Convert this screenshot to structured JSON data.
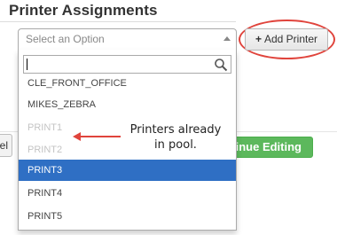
{
  "section": {
    "title": "Printer Assignments"
  },
  "select": {
    "placeholder": "Select an Option",
    "search_value": ""
  },
  "add_button": {
    "label": "Add Printer",
    "icon": "plus-icon"
  },
  "options": [
    {
      "label": "CLE_FRONT_OFFICE",
      "disabled": false
    },
    {
      "label": "MIKES_ZEBRA",
      "disabled": false
    },
    {
      "label": "PRINT1",
      "disabled": true
    },
    {
      "label": "PRINT2",
      "disabled": true
    },
    {
      "label": "PRINT3",
      "disabled": false,
      "highlighted": true
    },
    {
      "label": "PRINT4",
      "disabled": false
    },
    {
      "label": "PRINT5",
      "disabled": false
    }
  ],
  "annotation": {
    "line1": "Printers already",
    "line2": "in pool."
  },
  "background_buttons": {
    "cancel_partial": "el",
    "continue_partial": "tinue Editing"
  },
  "colors": {
    "highlight": "#2f6fc4",
    "continue_green": "#5cb85c",
    "annotation_red": "#e0443c",
    "disabled_text": "#c4c4c4"
  }
}
